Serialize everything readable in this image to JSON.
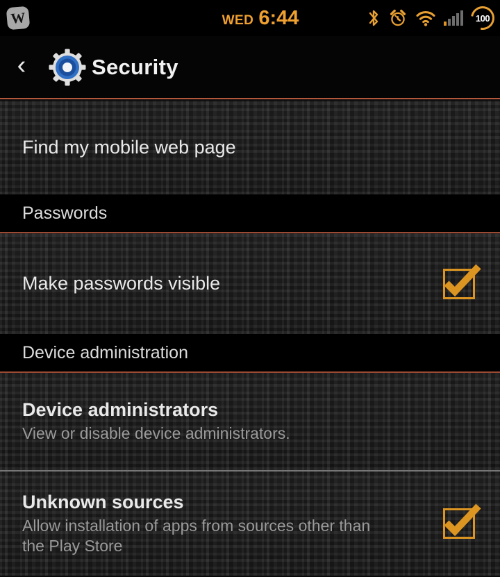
{
  "status_bar": {
    "notification_icon": "wordpress-app-icon",
    "notification_letter": "W",
    "day": "WED",
    "time": "6:44",
    "icons": [
      "bluetooth-icon",
      "alarm-icon",
      "wifi-icon",
      "signal-icon",
      "battery-icon"
    ],
    "battery_level": "100",
    "accent_color": "#e8a033"
  },
  "action_bar": {
    "back_icon": "back-chevron-icon",
    "back_glyph": "‹",
    "app_icon": "settings-gear-icon",
    "title": "Security",
    "underline_color": "#b5573a"
  },
  "list": [
    {
      "kind": "item",
      "name": "find-my-mobile-web-page",
      "title": "Find my mobile web page",
      "subtitle": "",
      "bold": false,
      "checkbox": null
    },
    {
      "kind": "header",
      "name": "passwords-header",
      "title": "Passwords"
    },
    {
      "kind": "item",
      "name": "make-passwords-visible",
      "title": "Make passwords visible",
      "subtitle": "",
      "bold": false,
      "checkbox": "checked"
    },
    {
      "kind": "header",
      "name": "device-administration-header",
      "title": "Device administration"
    },
    {
      "kind": "item",
      "name": "device-administrators",
      "title": "Device administrators",
      "subtitle": "View or disable device administrators.",
      "bold": true,
      "checkbox": null
    },
    {
      "kind": "item",
      "name": "unknown-sources",
      "title": "Unknown sources",
      "subtitle": "Allow installation of apps from sources other than the Play Store",
      "bold": true,
      "checkbox": "checked"
    }
  ],
  "theme": {
    "checkbox_color": "#dd9522",
    "title_color": "#e9e9e9",
    "subtitle_color": "#9a9a9a",
    "divider_color": "#9b9b9b"
  }
}
